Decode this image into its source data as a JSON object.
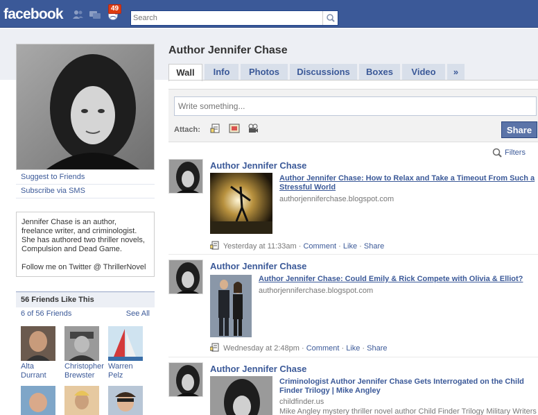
{
  "topbar": {
    "logo": "facebook",
    "notification_count": "49",
    "search_placeholder": "Search"
  },
  "profile": {
    "name": "Author Jennifer Chase",
    "links": [
      "Suggest to Friends",
      "Subscribe via SMS"
    ],
    "bio_1": "Jennifer Chase is an author, freelance writer, and criminologist. She has authored two thriller novels, Compulsion and Dead Game.",
    "bio_2": "Follow me on Twitter @ ThrillerNovel"
  },
  "friends": {
    "title": "56 Friends Like This",
    "count_label": "6 of 56 Friends",
    "see_all": "See All",
    "items": [
      {
        "name": "Alta Durrant"
      },
      {
        "name": "Christopher Brewster"
      },
      {
        "name": "Warren Pelz"
      },
      {
        "name": ""
      },
      {
        "name": ""
      },
      {
        "name": ""
      }
    ]
  },
  "tabs": [
    "Wall",
    "Info",
    "Photos",
    "Discussions",
    "Boxes",
    "Video",
    "»"
  ],
  "composer": {
    "placeholder": "Write something...",
    "attach_label": "Attach:",
    "share_label": "Share"
  },
  "filters_label": "Filters",
  "stories": [
    {
      "actor": "Author Jennifer Chase",
      "title": "Author Jennifer Chase: How to Relax and Take a Timeout From Such a Stressful World",
      "domain": "authorjenniferchase.blogspot.com",
      "time": "Yesterday at 11:33am",
      "actions": [
        "Comment",
        "Like",
        "Share"
      ]
    },
    {
      "actor": "Author Jennifer Chase",
      "title": "Author Jennifer Chase: Could Emily & Rick Compete with Olivia & Elliot?",
      "domain": "authorjenniferchase.blogspot.com",
      "time": "Wednesday at 2:48pm",
      "actions": [
        "Comment",
        "Like",
        "Share"
      ]
    },
    {
      "actor": "Author Jennifer Chase",
      "title": "Criminologist Author Jennifer Chase Gets Interrogated on the Child Finder Trilogy | Mike Angley",
      "domain": "childfinder.us",
      "description": "Mike Angley mystery thriller novel author Child Finder Trilogy Military Writers"
    }
  ],
  "colors": {
    "brand": "#3b5998",
    "badge": "#dd3c10",
    "tab_bg": "#d8dfea"
  }
}
